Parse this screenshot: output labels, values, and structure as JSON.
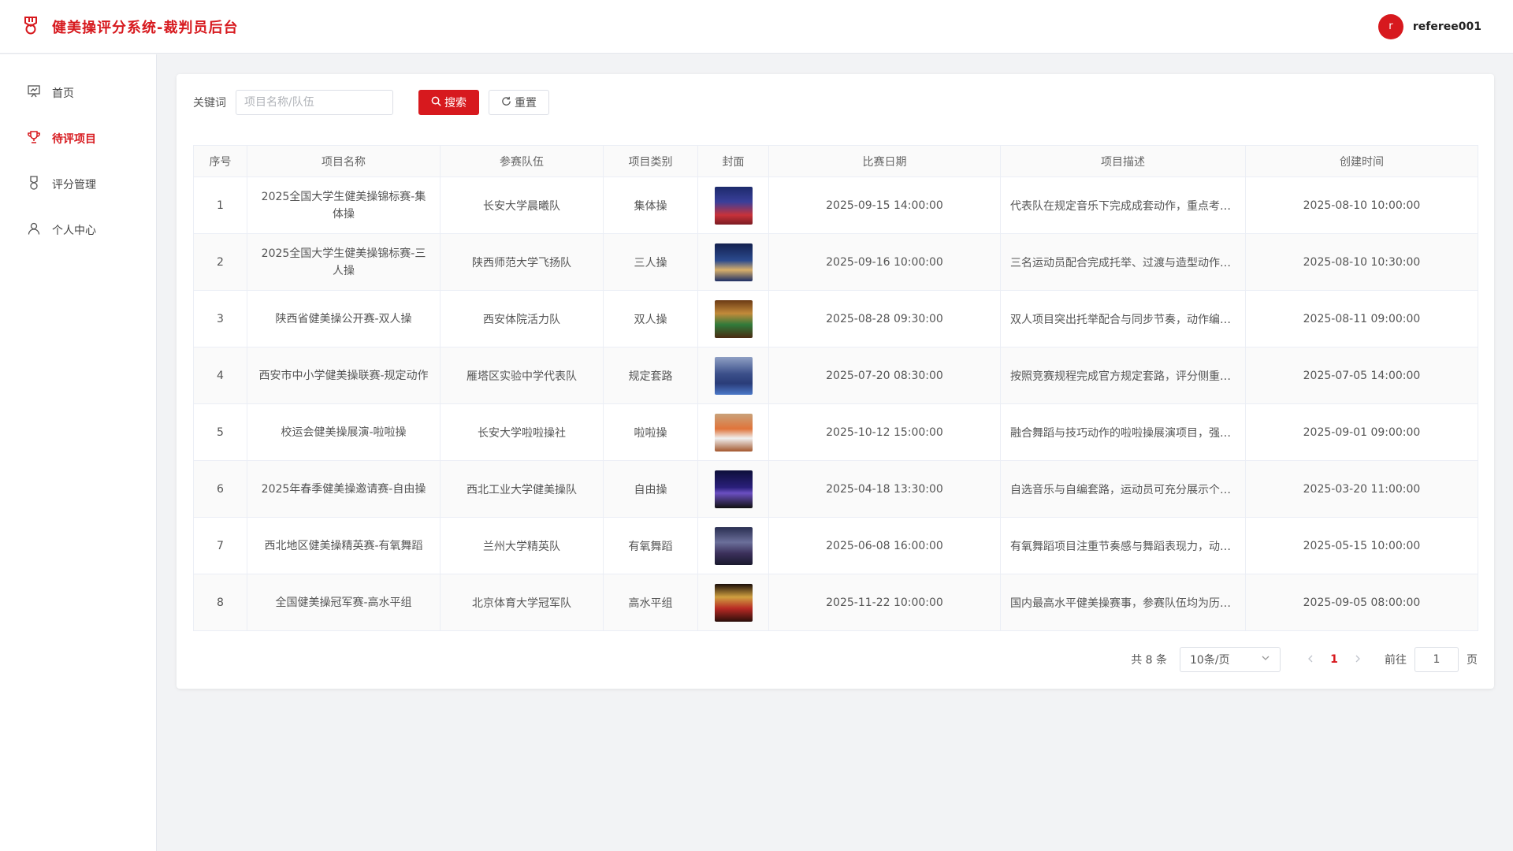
{
  "header": {
    "title": "健美操评分系统-裁判员后台",
    "avatar_letter": "r",
    "username": "referee001",
    "brand_color": "#d7191e"
  },
  "sidebar": {
    "items": [
      {
        "label": "首页",
        "icon": "presentation-icon",
        "active": false
      },
      {
        "label": "待评项目",
        "icon": "trophy-icon",
        "active": true
      },
      {
        "label": "评分管理",
        "icon": "medal-icon",
        "active": false
      },
      {
        "label": "个人中心",
        "icon": "user-icon",
        "active": false
      }
    ]
  },
  "search": {
    "label": "关键词",
    "placeholder": "项目名称/队伍",
    "value": "",
    "search_label": "搜索",
    "reset_label": "重置"
  },
  "table": {
    "columns": [
      "序号",
      "项目名称",
      "参赛队伍",
      "项目类别",
      "封面",
      "比赛日期",
      "项目描述",
      "创建时间"
    ],
    "rows": [
      {
        "index": "1",
        "name": "2025全国大学生健美操锦标赛-集体操",
        "team": "长安大学晨曦队",
        "category": "集体操",
        "cover": "cover-stage-red",
        "date": "2025-09-15 14:00:00",
        "desc": "代表队在规定音乐下完成成套动作，重点考…",
        "created": "2025-08-10 10:00:00"
      },
      {
        "index": "2",
        "name": "2025全国大学生健美操锦标赛-三人操",
        "team": "陕西师范大学飞扬队",
        "category": "三人操",
        "cover": "cover-stage-blue",
        "date": "2025-09-16 10:00:00",
        "desc": "三名运动员配合完成托举、过渡与造型动作…",
        "created": "2025-08-10 10:30:00"
      },
      {
        "index": "3",
        "name": "陕西省健美操公开赛-双人操",
        "team": "西安体院活力队",
        "category": "双人操",
        "cover": "cover-stage-green",
        "date": "2025-08-28 09:30:00",
        "desc": "双人项目突出托举配合与同步节奏，动作编…",
        "created": "2025-08-11 09:00:00"
      },
      {
        "index": "4",
        "name": "西安市中小学健美操联赛-规定动作",
        "team": "雁塔区实验中学代表队",
        "category": "规定套路",
        "cover": "cover-stage-lightblue",
        "date": "2025-07-20 08:30:00",
        "desc": "按照竞赛规程完成官方规定套路，评分侧重…",
        "created": "2025-07-05 14:00:00"
      },
      {
        "index": "5",
        "name": "校运会健美操展演-啦啦操",
        "team": "长安大学啦啦操社",
        "category": "啦啦操",
        "cover": "cover-stage-orange",
        "date": "2025-10-12 15:00:00",
        "desc": "融合舞蹈与技巧动作的啦啦操展演项目，强…",
        "created": "2025-09-01 09:00:00"
      },
      {
        "index": "6",
        "name": "2025年春季健美操邀请赛-自由操",
        "team": "西北工业大学健美操队",
        "category": "自由操",
        "cover": "cover-stage-purple",
        "date": "2025-04-18 13:30:00",
        "desc": "自选音乐与自编套路，运动员可充分展示个…",
        "created": "2025-03-20 11:00:00"
      },
      {
        "index": "7",
        "name": "西北地区健美操精英赛-有氧舞蹈",
        "team": "兰州大学精英队",
        "category": "有氧舞蹈",
        "cover": "cover-stage-navy",
        "date": "2025-06-08 16:00:00",
        "desc": "有氧舞蹈项目注重节奏感与舞蹈表现力，动…",
        "created": "2025-05-15 10:00:00"
      },
      {
        "index": "8",
        "name": "全国健美操冠军赛-高水平组",
        "team": "北京体育大学冠军队",
        "category": "高水平组",
        "cover": "cover-stage-dark",
        "date": "2025-11-22 10:00:00",
        "desc": "国内最高水平健美操赛事，参赛队伍均为历…",
        "created": "2025-09-05 08:00:00"
      }
    ]
  },
  "pagination": {
    "total": "共 8 条",
    "page_size": "10条/页",
    "current_page": "1",
    "goto_label": "前往",
    "goto_value": "1",
    "page_unit": "页"
  }
}
